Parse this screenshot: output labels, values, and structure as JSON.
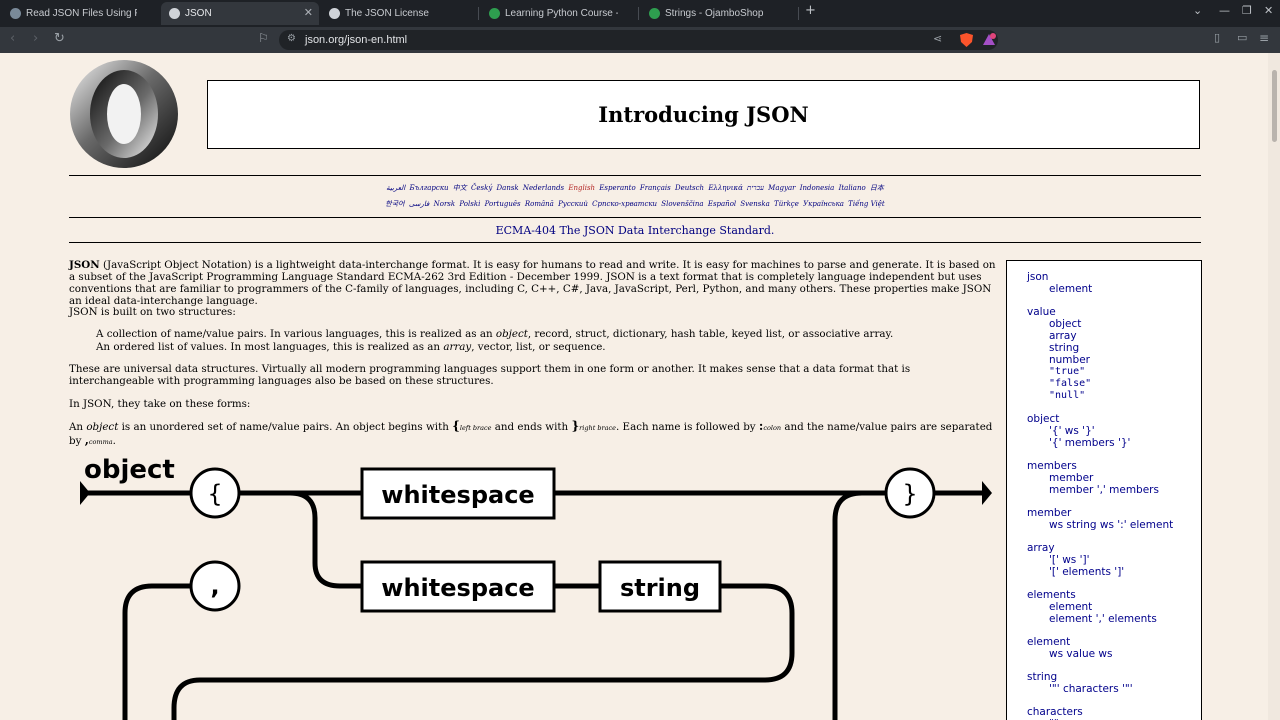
{
  "tabs": [
    {
      "title": "Read JSON Files Using Python -",
      "active": false
    },
    {
      "title": "JSON",
      "active": true
    },
    {
      "title": "The JSON License",
      "active": false
    },
    {
      "title": "Learning Python Course - Ojam",
      "active": false
    },
    {
      "title": "Strings - OjamboShop",
      "active": false
    }
  ],
  "toolbar": {
    "url": "json.org/json-en.html"
  },
  "page": {
    "title": "Introducing JSON",
    "languages_line1": [
      "العربية",
      "Български",
      "中文",
      "Český",
      "Dansk",
      "Nederlands",
      "English",
      "Esperanto",
      "Français",
      "Deutsch",
      "Ελληνικά",
      "עברית",
      "Magyar",
      "Indonesia",
      "Italiano",
      "日本"
    ],
    "languages_line2": [
      "한국어",
      "فارسی",
      "Norsk",
      "Polski",
      "Português",
      "Română",
      "Русский",
      "Српско-хрватски",
      "Slovenščina",
      "Español",
      "Svenska",
      "Türkçe",
      "Українська",
      "Tiếng Việt"
    ],
    "current_language": "English",
    "ecma_link": "ECMA-404 The JSON Data Interchange Standard.",
    "intro_bold": "JSON",
    "intro_rest": " (JavaScript Object Notation) is a lightweight data-interchange format. It is easy for humans to read and write. It is easy for machines to parse and generate. It is based on a subset of the JavaScript Programming Language Standard ECMA-262 3rd Edition - December 1999. JSON is a text format that is completely language independent but uses conventions that are familiar to programmers of the C-family of languages, including C, C++, C#, Java, JavaScript, Perl, Python, and many others. These properties make JSON an ideal data-interchange language.",
    "built_on": "JSON is built on two structures:",
    "struct1_a": "A collection of name/value pairs. In various languages, this is realized as an ",
    "struct1_em": "object",
    "struct1_b": ", record, struct, dictionary, hash table, keyed list, or associative array.",
    "struct2_a": "An ordered list of values. In most languages, this is realized as an ",
    "struct2_em": "array",
    "struct2_b": ", vector, list, or sequence.",
    "universal": "These are universal data structures. Virtually all modern programming languages support them in one form or another. It makes sense that a data format that is interchangeable with programming languages also be based on these structures.",
    "forms": "In JSON, they take on these forms:",
    "object_def": {
      "a": "An ",
      "em": "object",
      "b": " is an unordered set of name/value pairs. An object begins with ",
      "lbrace": "{",
      "lbrace_label": "left brace",
      "c": " and ends with ",
      "rbrace": "}",
      "rbrace_label": "right brace",
      "d": ". Each name is followed by ",
      "colon": ":",
      "colon_label": "colon",
      "e": " and the name/value pairs are separated by ",
      "comma": ",",
      "comma_label": "comma",
      "f": "."
    }
  },
  "diagram": {
    "title": "object",
    "lbrace": "{",
    "rbrace": "}",
    "comma": ",",
    "box1": "whitespace",
    "box2": "whitespace",
    "box3": "string"
  },
  "grammar": [
    {
      "text": "json",
      "indent": false
    },
    {
      "text": "element",
      "indent": true
    },
    {
      "text": "value",
      "indent": false
    },
    {
      "text": "object",
      "indent": true
    },
    {
      "text": "array",
      "indent": true
    },
    {
      "text": "string",
      "indent": true
    },
    {
      "text": "number",
      "indent": true
    },
    {
      "text": "\"true\"",
      "indent": true,
      "mono": true
    },
    {
      "text": "\"false\"",
      "indent": true,
      "mono": true
    },
    {
      "text": "\"null\"",
      "indent": true,
      "mono": true
    },
    {
      "text": "object",
      "indent": false
    },
    {
      "text": "'{' ws '}'",
      "indent": true
    },
    {
      "text": "'{' members '}'",
      "indent": true
    },
    {
      "text": "members",
      "indent": false
    },
    {
      "text": "member",
      "indent": true
    },
    {
      "text": "member ',' members",
      "indent": true
    },
    {
      "text": "member",
      "indent": false
    },
    {
      "text": "ws string ws ':' element",
      "indent": true
    },
    {
      "text": "array",
      "indent": false
    },
    {
      "text": "'[' ws ']'",
      "indent": true
    },
    {
      "text": "'[' elements ']'",
      "indent": true
    },
    {
      "text": "elements",
      "indent": false
    },
    {
      "text": "element",
      "indent": true
    },
    {
      "text": "element ',' elements",
      "indent": true
    },
    {
      "text": "element",
      "indent": false
    },
    {
      "text": "ws value ws",
      "indent": true
    },
    {
      "text": "string",
      "indent": false
    },
    {
      "text": "'\"' characters '\"'",
      "indent": true
    },
    {
      "text": "characters",
      "indent": false
    },
    {
      "text": "\"\"",
      "indent": true
    }
  ]
}
